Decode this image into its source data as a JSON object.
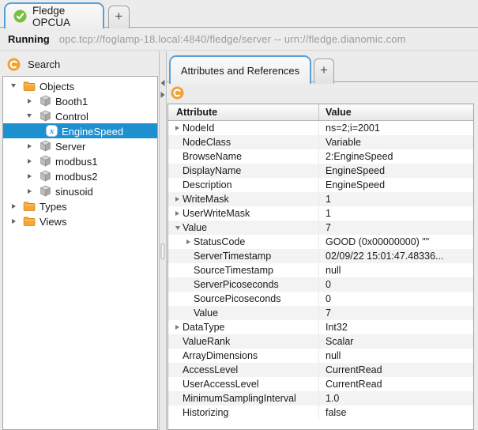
{
  "window": {
    "tab_label": "Fledge OPCUA",
    "new_tab_label": "+",
    "status_state": "Running",
    "status_url": "opc.tcp://foglamp-18.local:4840/fledge/server -- urn://fledge.dianomic.com"
  },
  "sidebar": {
    "toolbar_label": "Search",
    "tree": [
      {
        "label": "Objects",
        "icon": "folder",
        "expander": "open",
        "level": 0,
        "selected": false
      },
      {
        "label": "Booth1",
        "icon": "cube",
        "expander": "closed",
        "level": 1,
        "selected": false
      },
      {
        "label": "Control",
        "icon": "cube",
        "expander": "open",
        "level": 1,
        "selected": false
      },
      {
        "label": "EngineSpeed",
        "icon": "variable",
        "expander": "none",
        "level": 2,
        "selected": true
      },
      {
        "label": "Server",
        "icon": "cube",
        "expander": "closed",
        "level": 1,
        "selected": false
      },
      {
        "label": "modbus1",
        "icon": "cube",
        "expander": "closed",
        "level": 1,
        "selected": false
      },
      {
        "label": "modbus2",
        "icon": "cube",
        "expander": "closed",
        "level": 1,
        "selected": false
      },
      {
        "label": "sinusoid",
        "icon": "cube",
        "expander": "closed",
        "level": 1,
        "selected": false
      },
      {
        "label": "Types",
        "icon": "folder",
        "expander": "closed",
        "level": 0,
        "selected": false
      },
      {
        "label": "Views",
        "icon": "folder",
        "expander": "closed",
        "level": 0,
        "selected": false
      }
    ]
  },
  "main": {
    "tab_label": "Attributes and References",
    "new_tab_label": "+",
    "table": {
      "columns": [
        "Attribute",
        "Value"
      ],
      "rows": [
        {
          "attribute": "NodeId",
          "value": "ns=2;i=2001",
          "expander": "closed",
          "level": 0
        },
        {
          "attribute": "NodeClass",
          "value": "Variable",
          "expander": "none",
          "level": 0
        },
        {
          "attribute": "BrowseName",
          "value": "2:EngineSpeed",
          "expander": "none",
          "level": 0
        },
        {
          "attribute": "DisplayName",
          "value": "EngineSpeed",
          "expander": "none",
          "level": 0
        },
        {
          "attribute": "Description",
          "value": "EngineSpeed",
          "expander": "none",
          "level": 0
        },
        {
          "attribute": "WriteMask",
          "value": "1",
          "expander": "closed",
          "level": 0
        },
        {
          "attribute": "UserWriteMask",
          "value": "1",
          "expander": "closed",
          "level": 0
        },
        {
          "attribute": "Value",
          "value": "7",
          "expander": "open",
          "level": 0
        },
        {
          "attribute": "StatusCode",
          "value": "GOOD (0x00000000) \"\"",
          "expander": "closed",
          "level": 1
        },
        {
          "attribute": "ServerTimestamp",
          "value": "02/09/22 15:01:47.48336...",
          "expander": "none",
          "level": 1
        },
        {
          "attribute": "SourceTimestamp",
          "value": "null",
          "expander": "none",
          "level": 1
        },
        {
          "attribute": "ServerPicoseconds",
          "value": "0",
          "expander": "none",
          "level": 1
        },
        {
          "attribute": "SourcePicoseconds",
          "value": "0",
          "expander": "none",
          "level": 1
        },
        {
          "attribute": "Value",
          "value": "7",
          "expander": "none",
          "level": 1
        },
        {
          "attribute": "DataType",
          "value": "Int32",
          "expander": "closed",
          "level": 0
        },
        {
          "attribute": "ValueRank",
          "value": "Scalar",
          "expander": "none",
          "level": 0
        },
        {
          "attribute": "ArrayDimensions",
          "value": "null",
          "expander": "none",
          "level": 0
        },
        {
          "attribute": "AccessLevel",
          "value": "CurrentRead",
          "expander": "none",
          "level": 0
        },
        {
          "attribute": "UserAccessLevel",
          "value": "CurrentRead",
          "expander": "none",
          "level": 0
        },
        {
          "attribute": "MinimumSamplingInterval",
          "value": "1.0",
          "expander": "none",
          "level": 0
        },
        {
          "attribute": "Historizing",
          "value": "false",
          "expander": "none",
          "level": 0
        }
      ]
    }
  },
  "colors": {
    "tab_accent_blue": "#57a0d9",
    "selection_blue": "#1d90d0",
    "icon_orange": "#f0a232",
    "folder_orange": "#f8a832",
    "check_green": "#77c043",
    "stripe_gray": "#f3f3f3"
  }
}
